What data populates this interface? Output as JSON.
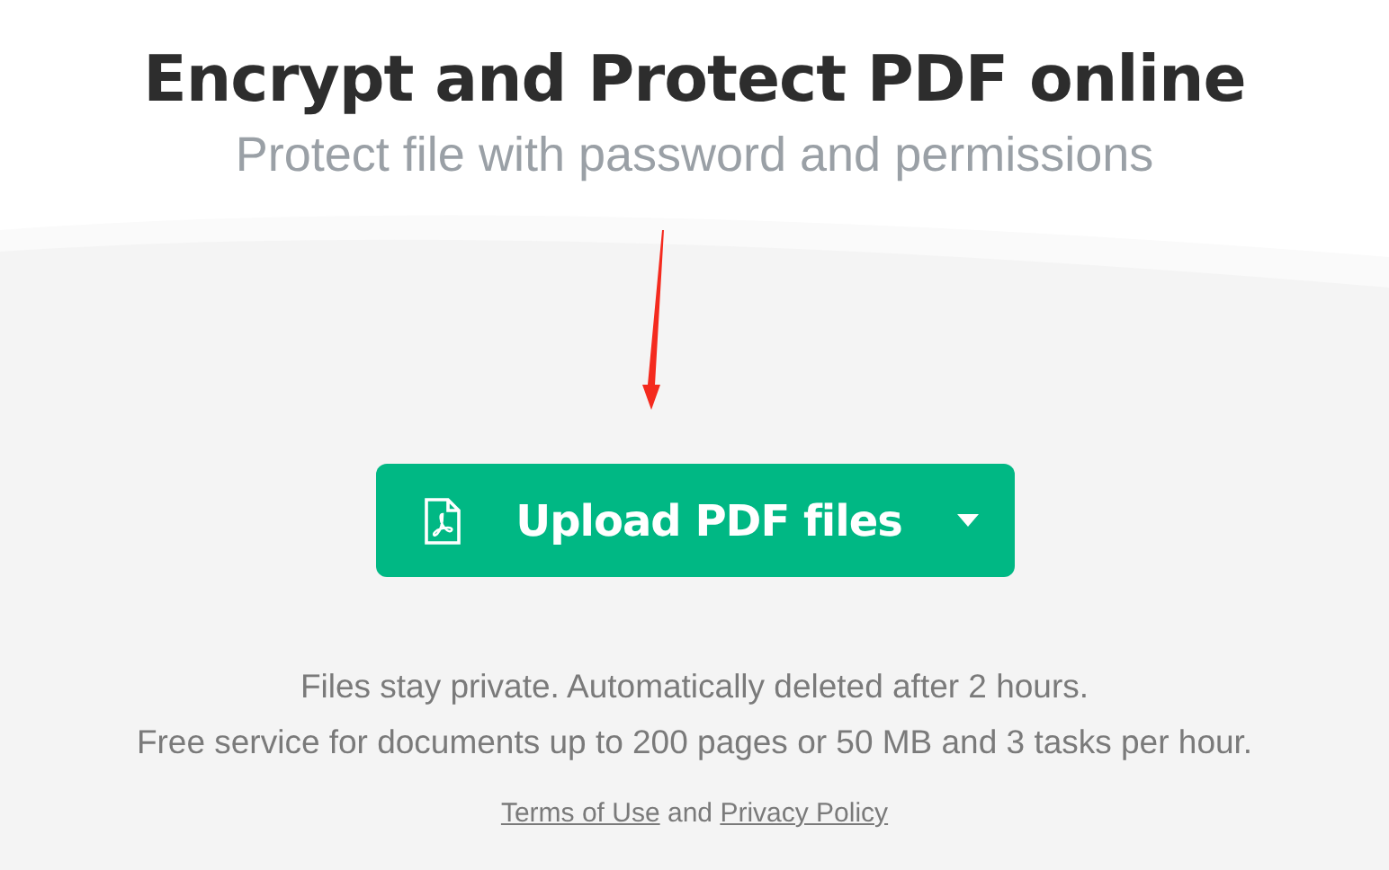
{
  "heading": {
    "title": "Encrypt and Protect PDF online",
    "subtitle": "Protect file with password and permissions"
  },
  "upload_button": {
    "label": "Upload PDF files"
  },
  "notes": [
    "Files stay private. Automatically deleted after 2 hours.",
    "Free service for documents up to 200 pages or 50 MB and 3 tasks per hour."
  ],
  "legal": {
    "terms": "Terms of Use",
    "conjunction": "and",
    "privacy": "Privacy Policy"
  }
}
